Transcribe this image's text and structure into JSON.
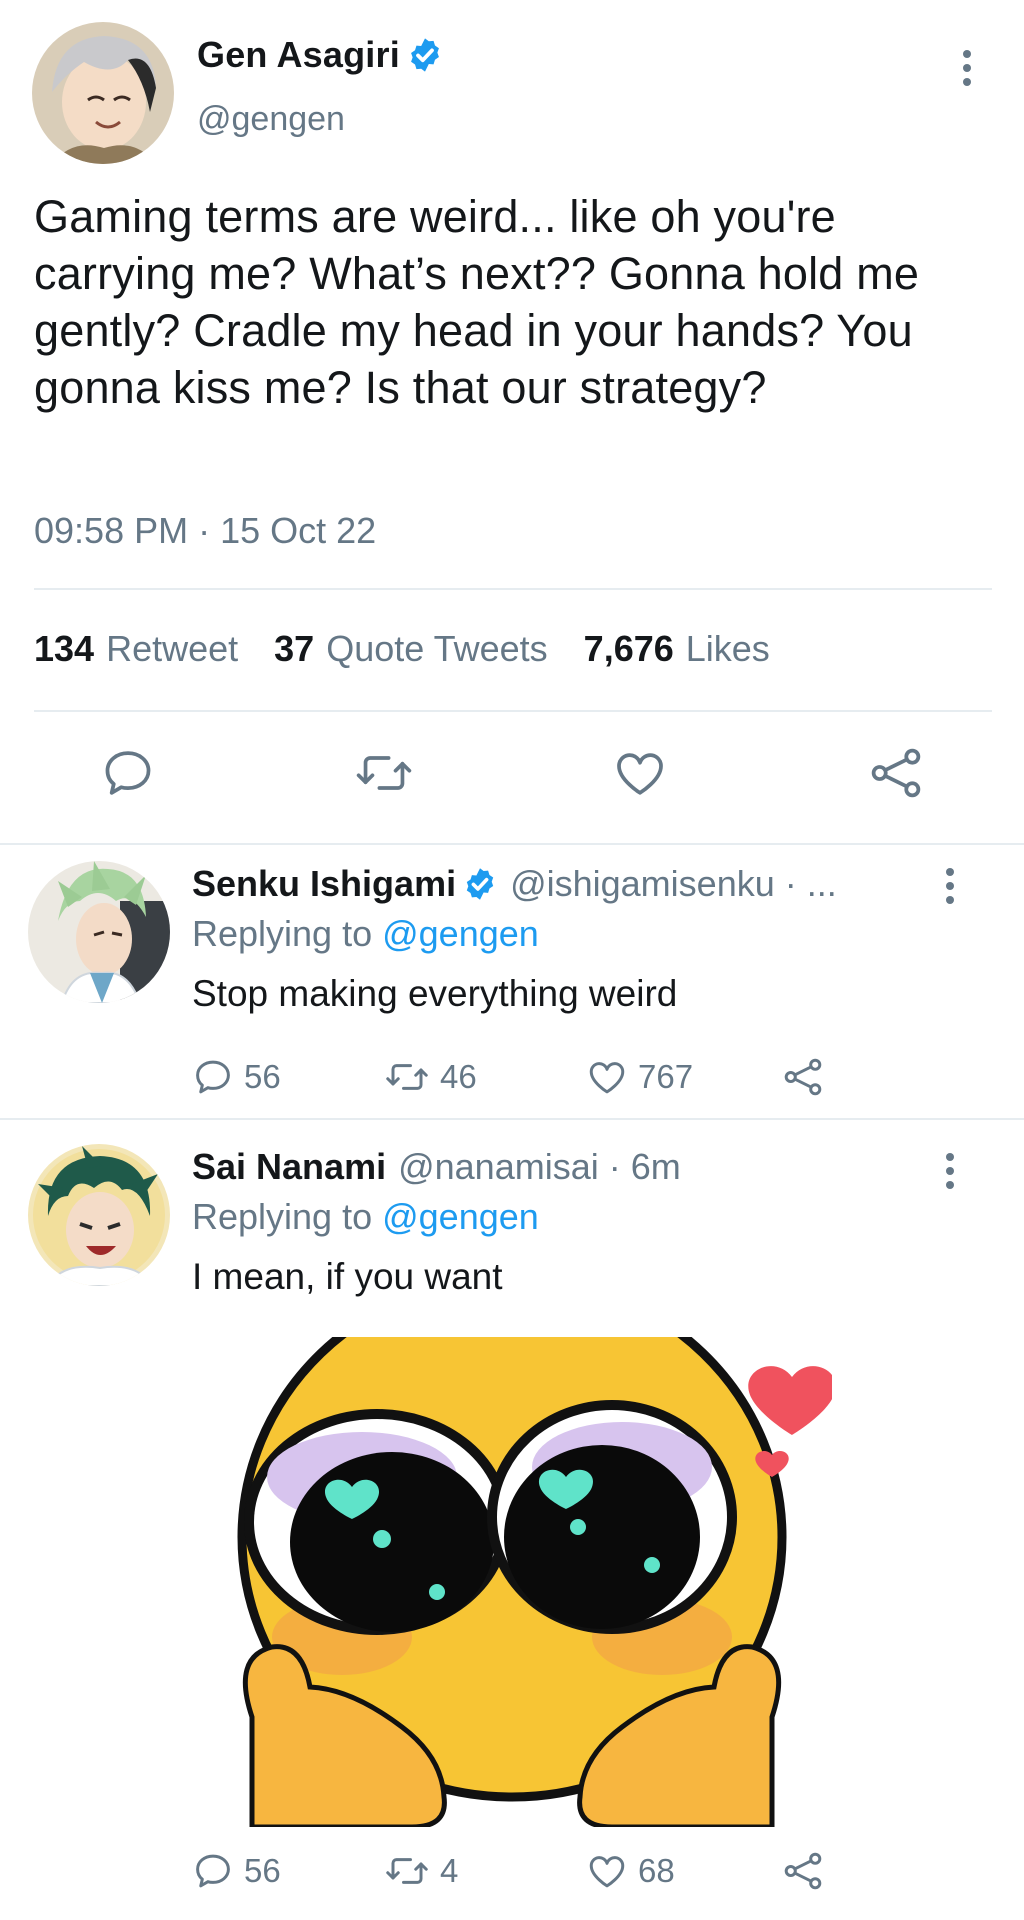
{
  "main_tweet": {
    "author_name": "Gen Asagiri",
    "author_handle": "@gengen",
    "verified": true,
    "text": "Gaming terms are weird... like oh you're carrying me? What’s next?? Gonna hold me gently? Cradle my head in your hands? You gonna kiss me? Is that our strategy?",
    "timestamp": "09:58 PM · 15 Oct 22",
    "stats": [
      {
        "count": "134",
        "label": "Retweet"
      },
      {
        "count": "37",
        "label": "Quote Tweets"
      },
      {
        "count": "7,676",
        "label": "Likes"
      }
    ],
    "actions": [
      "reply-icon",
      "retweet-icon",
      "like-icon",
      "share-icon"
    ]
  },
  "replies": [
    {
      "author_name": "Senku Ishigami",
      "verified": true,
      "author_handle": "@ishigamisenku · ...",
      "replying_label": "Replying to",
      "replying_handle": "@gengen",
      "text": "Stop making everything weird",
      "reply_count": "56",
      "retweet_count": "46",
      "like_count": "767"
    },
    {
      "author_name": "Sai Nanami",
      "verified": false,
      "author_handle": "@nanamisai · 6m",
      "replying_label": "Replying to",
      "replying_handle": "@gengen",
      "text": "I mean, if you want",
      "reply_count": "56",
      "retweet_count": "4",
      "like_count": "68",
      "media": "shy-emoji-sticker"
    }
  ],
  "colors": {
    "link": "#1d9bf0",
    "secondary_text": "#657786",
    "primary_text": "#14171a",
    "divider": "#e6ecf0",
    "verified_badge": "#1d9bf0"
  }
}
